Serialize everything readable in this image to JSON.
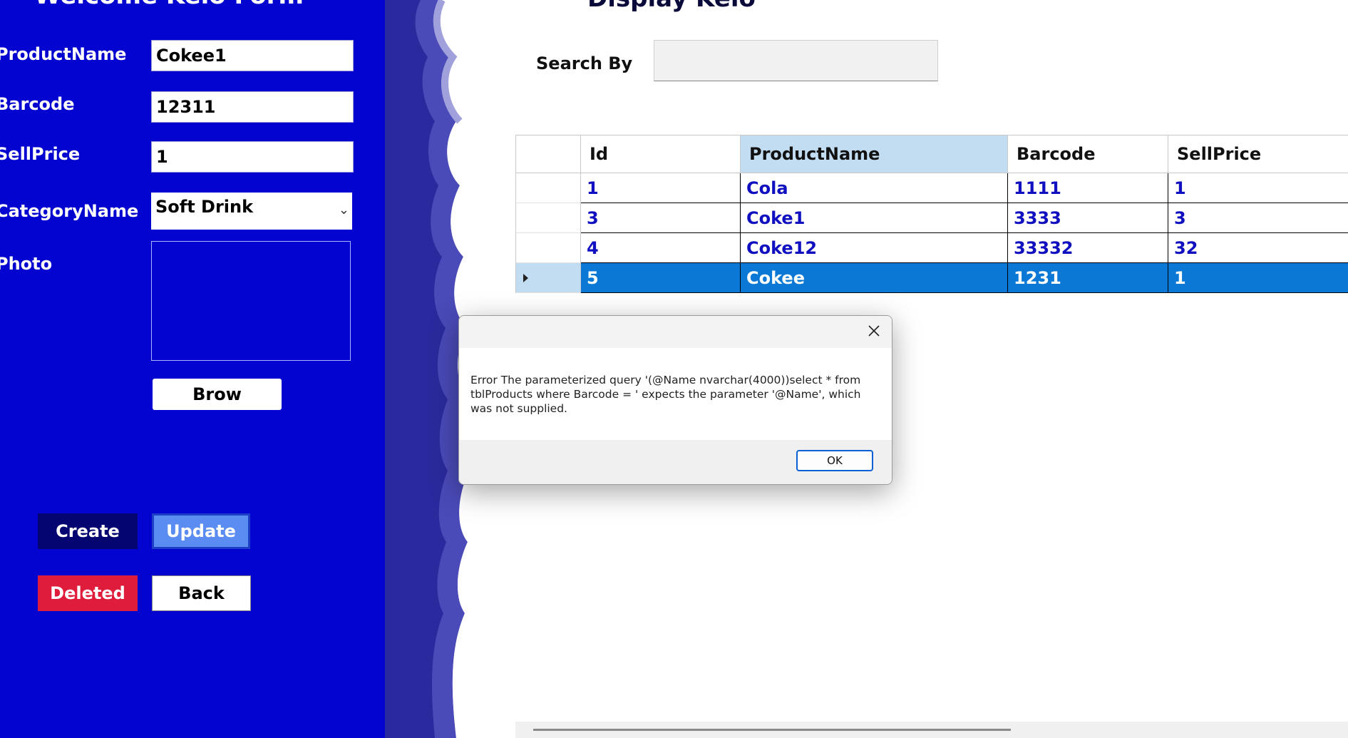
{
  "left_form": {
    "title": "Welcome Kelo Form",
    "fields": {
      "product_name": {
        "label": "ProductName",
        "value": "Cokee1"
      },
      "barcode": {
        "label": "Barcode",
        "value": "12311"
      },
      "sell_price": {
        "label": "SellPrice",
        "value": "1"
      },
      "category_name": {
        "label": "CategoryName",
        "value": "Soft Drink"
      },
      "photo": {
        "label": "Photo"
      }
    },
    "buttons": {
      "browse": "Brow",
      "create": "Create",
      "update": "Update",
      "deleted": "Deleted",
      "back": "Back"
    }
  },
  "right_panel": {
    "title": "Display Kelo",
    "search": {
      "label": "Search By",
      "value": ""
    },
    "grid": {
      "columns": [
        "Id",
        "ProductName",
        "Barcode",
        "SellPrice"
      ],
      "active_column": "ProductName",
      "rows": [
        {
          "id": "1",
          "product_name": "Cola",
          "barcode": "1111",
          "sell_price": "1"
        },
        {
          "id": "3",
          "product_name": "Coke1",
          "barcode": "3333",
          "sell_price": "3"
        },
        {
          "id": "4",
          "product_name": "Coke12",
          "barcode": "33332",
          "sell_price": "32"
        },
        {
          "id": "5",
          "product_name": "Cokee",
          "barcode": "1231",
          "sell_price": "1"
        }
      ],
      "selected_row": 3
    }
  },
  "dialog": {
    "message": "Error The parameterized query '(@Name nvarchar(4000))select * from tblProducts where Barcode = ' expects the parameter '@Name', which was not supplied.",
    "ok_label": "OK",
    "close_icon": "close-icon"
  },
  "colors": {
    "panel_blue": "#0404d0",
    "create_button": "#050572",
    "update_button": "#5a8cf2",
    "deleted_button": "#e01c3c",
    "grid_text": "#1010c0",
    "selected_row": "#0b78d6"
  }
}
